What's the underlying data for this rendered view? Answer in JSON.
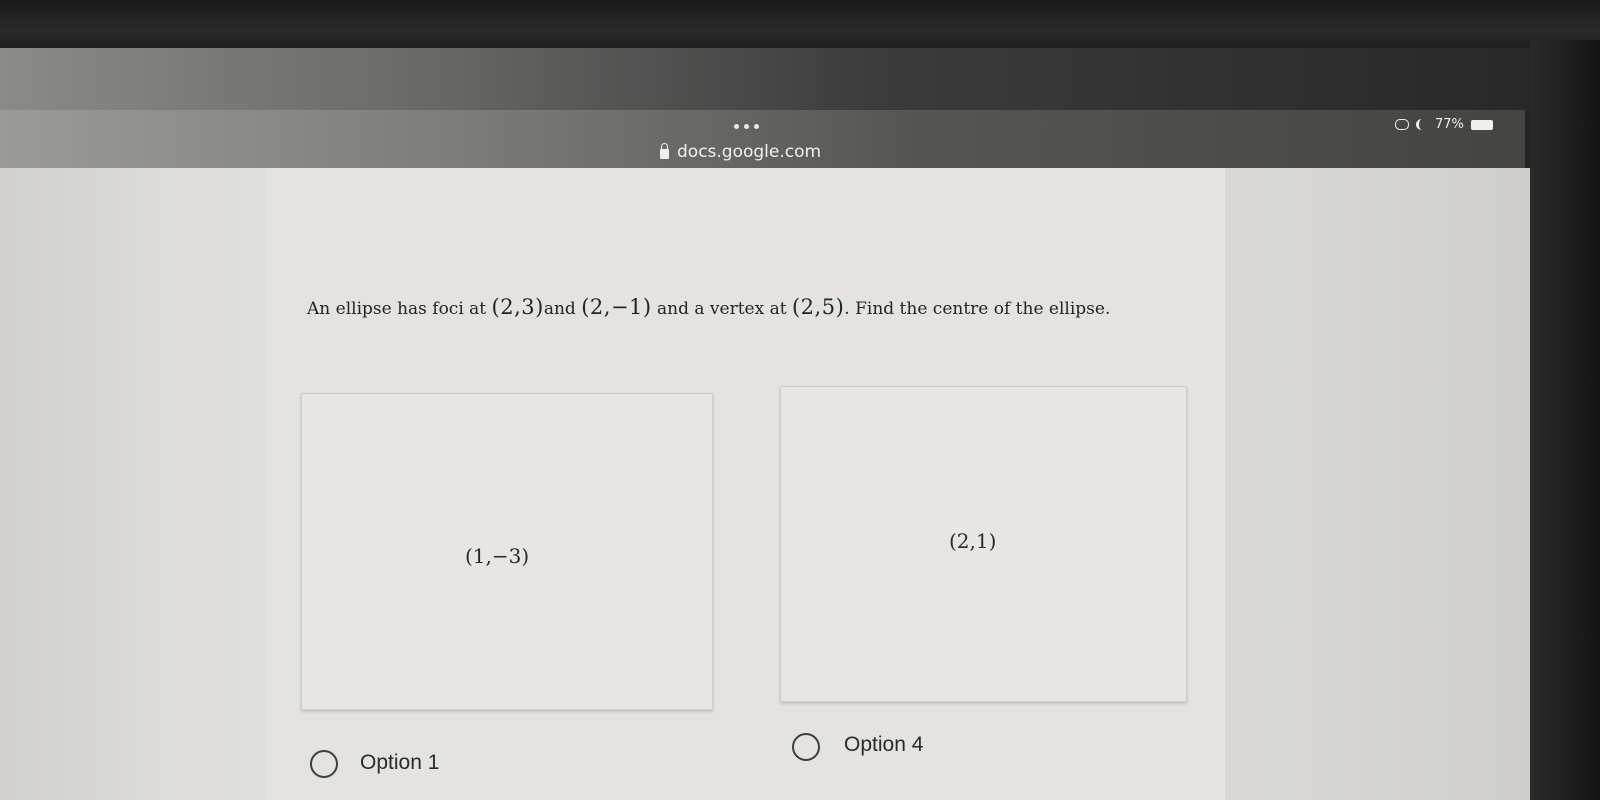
{
  "browser": {
    "url": "docs.google.com",
    "battery": "77%"
  },
  "question": {
    "prefix": "An ellipse has foci at",
    "focus1": "(2,3)",
    "and1": "and",
    "focus2": "(2,−1)",
    "mid": "and a vertex at",
    "vertex": "(2,5)",
    "suffix": ". Find the centre of the ellipse."
  },
  "options": [
    {
      "box_text": "(1,−3)",
      "label": "Option 1"
    },
    {
      "box_text": "(2,1)",
      "label": "Option 4"
    }
  ]
}
